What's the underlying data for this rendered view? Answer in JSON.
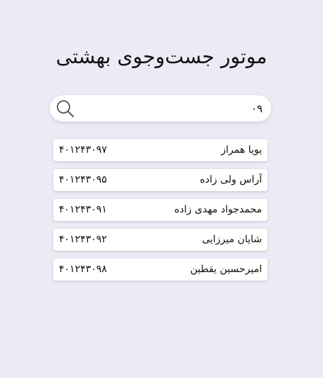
{
  "title": "موتور جست‌وجوی بهشتی",
  "search": {
    "value": "۰۹",
    "icon": "search-icon"
  },
  "results": [
    {
      "name": "پویا همراز",
      "id": "۴۰۱۲۴۳۰۹۷"
    },
    {
      "name": "آراس ولی زاده",
      "id": "۴۰۱۲۴۳۰۹۵"
    },
    {
      "name": "محمدجواد مهدی زاده",
      "id": "۴۰۱۲۴۳۰۹۱"
    },
    {
      "name": "شایان میرزایی",
      "id": "۴۰۱۲۴۳۰۹۲"
    },
    {
      "name": "امیرحسین یقطین",
      "id": "۴۰۱۲۴۳۰۹۸"
    }
  ]
}
